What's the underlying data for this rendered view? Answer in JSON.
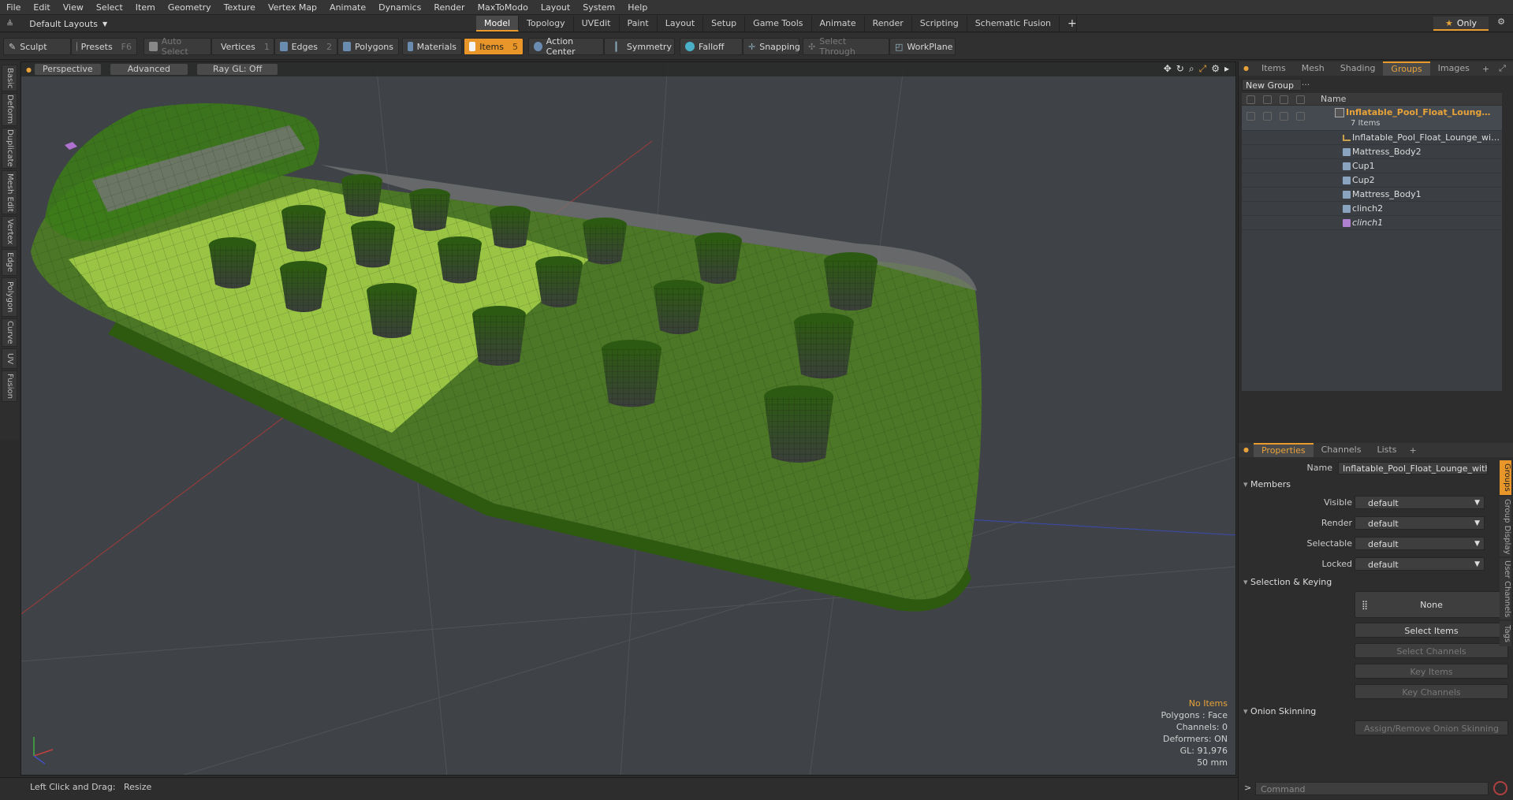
{
  "menu": [
    "File",
    "Edit",
    "View",
    "Select",
    "Item",
    "Geometry",
    "Texture",
    "Vertex Map",
    "Animate",
    "Dynamics",
    "Render",
    "MaxToModo",
    "Layout",
    "System",
    "Help"
  ],
  "layout": {
    "dropdown_label": "Default Layouts",
    "tabs": [
      "Model",
      "Topology",
      "UVEdit",
      "Paint",
      "Layout",
      "Setup",
      "Game Tools",
      "Animate",
      "Render",
      "Scripting",
      "Schematic Fusion"
    ],
    "active_tab": "Model",
    "only_label": "Only"
  },
  "toolbar": {
    "sculpt": "Sculpt",
    "presets": "Presets",
    "presets_key": "F6",
    "auto_select": "Auto Select",
    "vertices": "Vertices",
    "vertices_key": "1",
    "edges": "Edges",
    "edges_key": "2",
    "polygons": "Polygons",
    "materials": "Materials",
    "items": "Items",
    "items_key": "5",
    "action_center": "Action Center",
    "symmetry": "Symmetry",
    "falloff": "Falloff",
    "snapping": "Snapping",
    "select_through": "Select Through",
    "workplane": "WorkPlane"
  },
  "left_tabs": [
    "Basic",
    "Deform",
    "Duplicate",
    "Mesh Edit",
    "Vertex",
    "Edge",
    "Polygon",
    "Curve",
    "UV",
    "Fusion"
  ],
  "viewport": {
    "view": "Perspective",
    "shading": "Advanced",
    "raygl": "Ray GL: Off",
    "info": {
      "selection": "No Items",
      "polygons": "Polygons : Face",
      "channels": "Channels: 0",
      "deformers": "Deformers: ON",
      "gl": "GL: 91,976",
      "grid": "50 mm"
    }
  },
  "status": "Left Click and Drag:   Resize",
  "items_panel": {
    "tabs": [
      "Items",
      "Mesh ...",
      "Shading",
      "Groups",
      "Images"
    ],
    "active_tab": "Groups",
    "new_group": "New Group",
    "col_name": "Name",
    "root": {
      "label": "Inflatable_Pool_Float_Lounge_wi...",
      "sub": "7 Items"
    },
    "children": [
      {
        "label": "Inflatable_Pool_Float_Lounge_with_...",
        "type": "locator"
      },
      {
        "label": "Mattress_Body2",
        "type": "mesh"
      },
      {
        "label": "Cup1",
        "type": "mesh"
      },
      {
        "label": "Cup2",
        "type": "mesh"
      },
      {
        "label": "Mattress_Body1",
        "type": "mesh"
      },
      {
        "label": "clinch2",
        "type": "mesh"
      },
      {
        "label": "clinch1",
        "type": "locked"
      }
    ]
  },
  "properties": {
    "tabs": [
      "Properties",
      "Channels",
      "Lists"
    ],
    "active_tab": "Properties",
    "name_label": "Name",
    "name_value": "Inflatable_Pool_Float_Lounge_with_He",
    "members_section": "Members",
    "rows": [
      {
        "label": "Visible",
        "value": "default"
      },
      {
        "label": "Render",
        "value": "default"
      },
      {
        "label": "Selectable",
        "value": "default"
      },
      {
        "label": "Locked",
        "value": "default"
      }
    ],
    "selection_section": "Selection & Keying",
    "none_label": "None",
    "select_items": "Select Items",
    "select_channels": "Select Channels",
    "key_items": "Key Items",
    "key_channels": "Key Channels",
    "onion_section": "Onion Skinning",
    "onion_button": "Assign/Remove Onion Skinning",
    "side_tabs": [
      "Groups",
      "Group Display",
      "User Channels",
      "Tags"
    ]
  },
  "command_placeholder": "Command",
  "colors": {
    "accent": "#e8962a",
    "mesh_green": "#6fa12e",
    "viewport_bg": "#3f4347"
  }
}
